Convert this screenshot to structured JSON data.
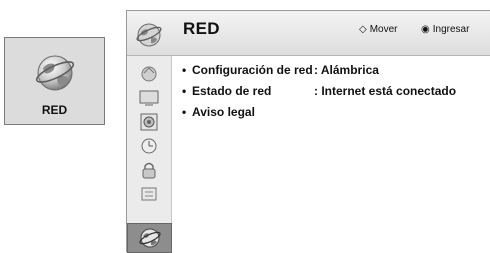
{
  "tile": {
    "label": "RED",
    "icon": "globe-icon"
  },
  "header": {
    "title": "RED",
    "move_glyph": "◇",
    "move_label": "Mover",
    "enter_glyph": "◉",
    "enter_label": "Ingresar"
  },
  "sidebar": {
    "items": [
      {
        "icon": "picture-icon"
      },
      {
        "icon": "screen-icon"
      },
      {
        "icon": "audio-icon"
      },
      {
        "icon": "clock-icon"
      },
      {
        "icon": "lock-icon"
      },
      {
        "icon": "options-icon"
      },
      {
        "icon": "network-globe-icon",
        "active": true
      }
    ]
  },
  "menu": {
    "bullet": "•",
    "items": [
      {
        "label": "Configuración de red",
        "value": ": Alámbrica"
      },
      {
        "label": "Estado de red",
        "value": ": Internet está conectado"
      },
      {
        "label": "Aviso legal",
        "value": ""
      }
    ]
  }
}
